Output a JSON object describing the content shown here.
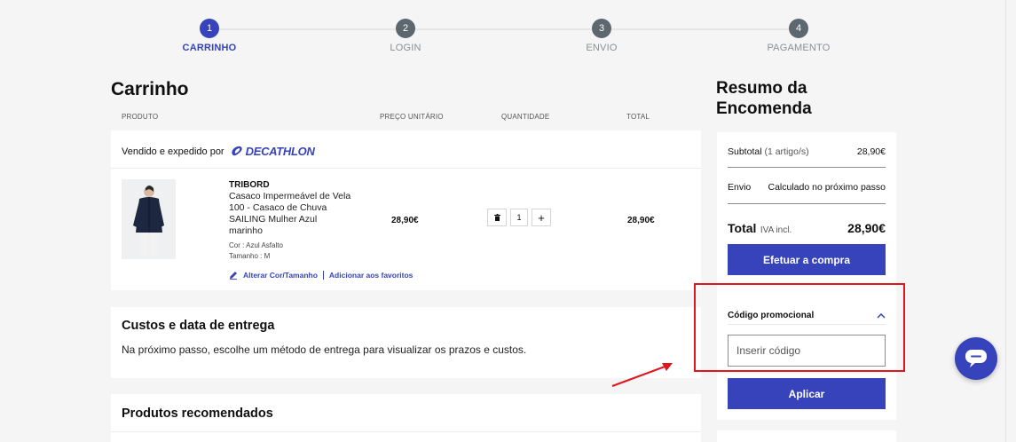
{
  "stepper": {
    "steps": [
      {
        "number": "1",
        "label": "CARRINHO"
      },
      {
        "number": "2",
        "label": "LOGIN"
      },
      {
        "number": "3",
        "label": "ENVIO"
      },
      {
        "number": "4",
        "label": "PAGAMENTO"
      }
    ],
    "active_step": 1
  },
  "cart": {
    "title": "Carrinho",
    "columns": {
      "product": "PRODUTO",
      "unit_price": "PREÇO UNITÁRIO",
      "quantity": "QUANTIDADE",
      "total": "TOTAL"
    },
    "seller_prefix": "Vendido e expedido por",
    "seller_brand": "DECATHLON",
    "item": {
      "brand": "TRIBORD",
      "name": "Casaco Impermeável de Vela 100 - Casaco de Chuva SAILING Mulher Azul marinho",
      "color": "Cor : Azul Asfalto",
      "size": "Tamanho : M",
      "unit_price": "28,90€",
      "quantity": "1",
      "total": "28,90€",
      "change_link": "Alterar Cor/Tamanho",
      "favorite_link": "Adicionar aos favoritos"
    }
  },
  "delivery": {
    "title": "Custos e data de entrega",
    "text": "Na próximo passo, escolhe um método de entrega para visualizar os prazos e custos."
  },
  "recommended": {
    "title": "Produtos recomendados"
  },
  "summary": {
    "title": "Resumo da Encomenda",
    "subtotal_label": "Subtotal",
    "subtotal_count": "(1 artigo/s)",
    "subtotal_value": "28,90€",
    "shipping_label": "Envio",
    "shipping_value": "Calculado no próximo passo",
    "total_label": "Total",
    "total_note": "IVA incl.",
    "total_value": "28,90€",
    "checkout_button": "Efetuar a compra",
    "promo_title": "Código promocional",
    "promo_placeholder": "Inserir código",
    "apply_button": "Aplicar"
  },
  "colors": {
    "accent": "#3643ba",
    "highlight": "#e0161d",
    "background": "#f5f5f5"
  },
  "icons": [
    "trash-icon",
    "plus-icon",
    "pencil-icon",
    "chevron-up-icon",
    "chat-icon",
    "decathlon-logo-icon"
  ]
}
